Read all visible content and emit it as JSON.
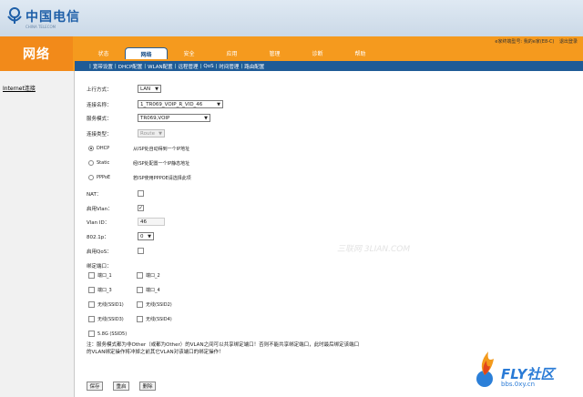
{
  "colors": {
    "brand_orange": "#f59a1e",
    "nav_blue": "#1f5b96",
    "logo_blue": "#1e5fa8"
  },
  "logo": {
    "text": "中国电信",
    "sub": "CHINA TELECOM"
  },
  "header": {
    "section_title": "网络",
    "user_info": "e家终端型号: 我的e家(E8-C)",
    "logout": "退出登录"
  },
  "tabs": [
    "状态",
    "网络",
    "安全",
    "应用",
    "管理",
    "诊断",
    "帮助"
  ],
  "active_tab": "网络",
  "subnav": [
    "宽带设置",
    "DHCP配置",
    "WLAN配置",
    "远程管理",
    "QoS",
    "时间管理",
    "路由配置"
  ],
  "sidebar": {
    "link": "Internet连接"
  },
  "form": {
    "uplink_label": "上行方式：",
    "uplink_value": "LAN",
    "conn_name_label": "连接名称：",
    "conn_name_value": "1_TR069_VOIP_R_VID_46",
    "service_label": "服务模式：",
    "service_value": "TR069,VOIP",
    "conn_type_label": "连接类型：",
    "conn_type_value": "Route",
    "modes": [
      {
        "label": "DHCP",
        "desc": "从ISP处自动得到一个IP地址",
        "selected": true
      },
      {
        "label": "Static",
        "desc": "经ISP处配置一个IP静态地址",
        "selected": false
      },
      {
        "label": "PPPoE",
        "desc": "若ISP使用PPPOE请选择此项",
        "selected": false
      }
    ],
    "nat_label": "NAT：",
    "vlan_enable_label": "启用Vlan：",
    "vlan_id_label": "Vlan ID：",
    "vlan_id_value": "46",
    "dot1p_label": "802.1p：",
    "dot1p_value": "0",
    "qos_label": "启用QoS：",
    "bind_label": "绑定端口：",
    "ports": [
      "端口_1",
      "端口_2",
      "端口_3",
      "端口_4",
      "无线(SSID1)",
      "无线(SSID2)",
      "无线(SSID3)",
      "无线(SSID4)",
      "5.8G (SSID5)"
    ],
    "note": "注：服务模式都为非Other（或都为Other）的VLAN之间可以共享绑定端口！否则不能共享绑定端口，此时最后绑定该端口的VLAN绑定操作将冲掉之前其它VLAN对该端口的绑定操作！"
  },
  "buttons": {
    "save": "保存",
    "reset": "重启",
    "delete": "删除"
  },
  "watermarks": {
    "center": "三联网 3LIAN.COM",
    "corner": "FLY社区",
    "corner_url": "bbs.0xy.cn"
  }
}
